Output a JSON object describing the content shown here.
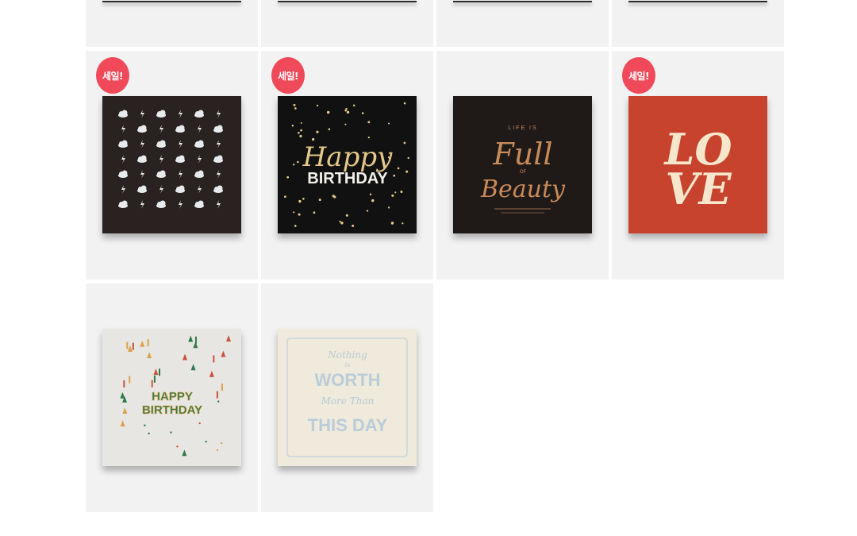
{
  "sale_badge_label": "세일!",
  "products": [
    {
      "row": 0,
      "col": 0,
      "design": "partial-top"
    },
    {
      "row": 0,
      "col": 1,
      "design": "partial-top"
    },
    {
      "row": 0,
      "col": 2,
      "design": "partial-top"
    },
    {
      "row": 0,
      "col": 3,
      "design": "partial-top"
    },
    {
      "row": 1,
      "col": 0,
      "design": "clouds-lightning-card",
      "sale": true,
      "card_color": "#2a2220"
    },
    {
      "row": 1,
      "col": 1,
      "design": "happy-birthday-black-card",
      "sale": true,
      "card_color": "#111111",
      "texts": [
        "Happy",
        "BIRTHDAY"
      ]
    },
    {
      "row": 1,
      "col": 2,
      "design": "life-full-of-beauty-card",
      "sale": false,
      "card_color": "#1f1a18",
      "texts": [
        "LIFE IS",
        "Full",
        "OF",
        "Beauty"
      ]
    },
    {
      "row": 1,
      "col": 3,
      "design": "love-red-card",
      "sale": true,
      "card_color": "#c8432e",
      "texts": [
        "LO",
        "VE"
      ]
    },
    {
      "row": 2,
      "col": 0,
      "design": "happy-birthday-party-card",
      "sale": false,
      "card_color": "#e8e6e2",
      "texts": [
        "HAPPY",
        "BIRTHDAY"
      ]
    },
    {
      "row": 2,
      "col": 1,
      "design": "nothing-worth-this-day-card",
      "sale": false,
      "card_color": "#efeadb",
      "texts": [
        "Nothing",
        "is",
        "WORTH",
        "More Than",
        "THIS DAY"
      ]
    }
  ],
  "colors": {
    "tile_bg": "#f2f2f2",
    "sale_badge": "#f04a5a",
    "gold": "#e6c98a",
    "copper": "#c98a5a"
  }
}
